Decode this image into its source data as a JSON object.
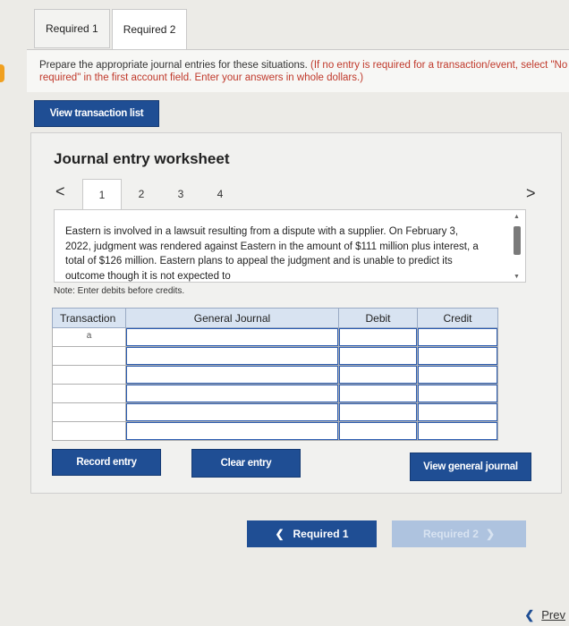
{
  "top_tabs": [
    {
      "label": "Required 1",
      "active": false
    },
    {
      "label": "Required 2",
      "active": true
    }
  ],
  "instructions": {
    "main": "Prepare the appropriate journal entries for these situations. ",
    "note": "(If no entry is required for a transaction/event, select \"No journal entry required\" in the first account field. Enter your answers in whole dollars.)",
    "line2": "required\" in the first account field. Enter your answers in whole dollars.)"
  },
  "view_transaction_label": "View transaction list",
  "worksheet": {
    "title": "Journal entry worksheet",
    "prev_arrow": "<",
    "next_arrow": ">",
    "steps": [
      "1",
      "2",
      "3",
      "4"
    ],
    "active_step": "1",
    "description": "Eastern is involved in a lawsuit resulting from a dispute with a supplier. On February 3, 2022, judgment was rendered against Eastern in the amount of $111 million plus interest, a total of $126 million. Eastern plans to appeal the judgment and is unable to predict its outcome though it is not expected to",
    "note": "Note: Enter debits before credits."
  },
  "journal_table": {
    "headers": {
      "transaction": "Transaction",
      "general_journal": "General Journal",
      "debit": "Debit",
      "credit": "Credit"
    },
    "rows": [
      {
        "transaction": "a",
        "account": "",
        "debit": "",
        "credit": ""
      },
      {
        "transaction": "",
        "account": "",
        "debit": "",
        "credit": ""
      },
      {
        "transaction": "",
        "account": "",
        "debit": "",
        "credit": ""
      },
      {
        "transaction": "",
        "account": "",
        "debit": "",
        "credit": ""
      },
      {
        "transaction": "",
        "account": "",
        "debit": "",
        "credit": ""
      },
      {
        "transaction": "",
        "account": "",
        "debit": "",
        "credit": ""
      }
    ]
  },
  "buttons": {
    "record_entry": "Record entry",
    "clear_entry": "Clear entry",
    "view_general_journal": "View general journal"
  },
  "bottom_nav": {
    "prev_label": "Required 1",
    "next_label": "Required 2"
  },
  "prev_link": "Prev",
  "colors": {
    "accent": "#1f4e94",
    "header_bg": "#d8e3f1",
    "disabled_btn": "#aec3df"
  }
}
